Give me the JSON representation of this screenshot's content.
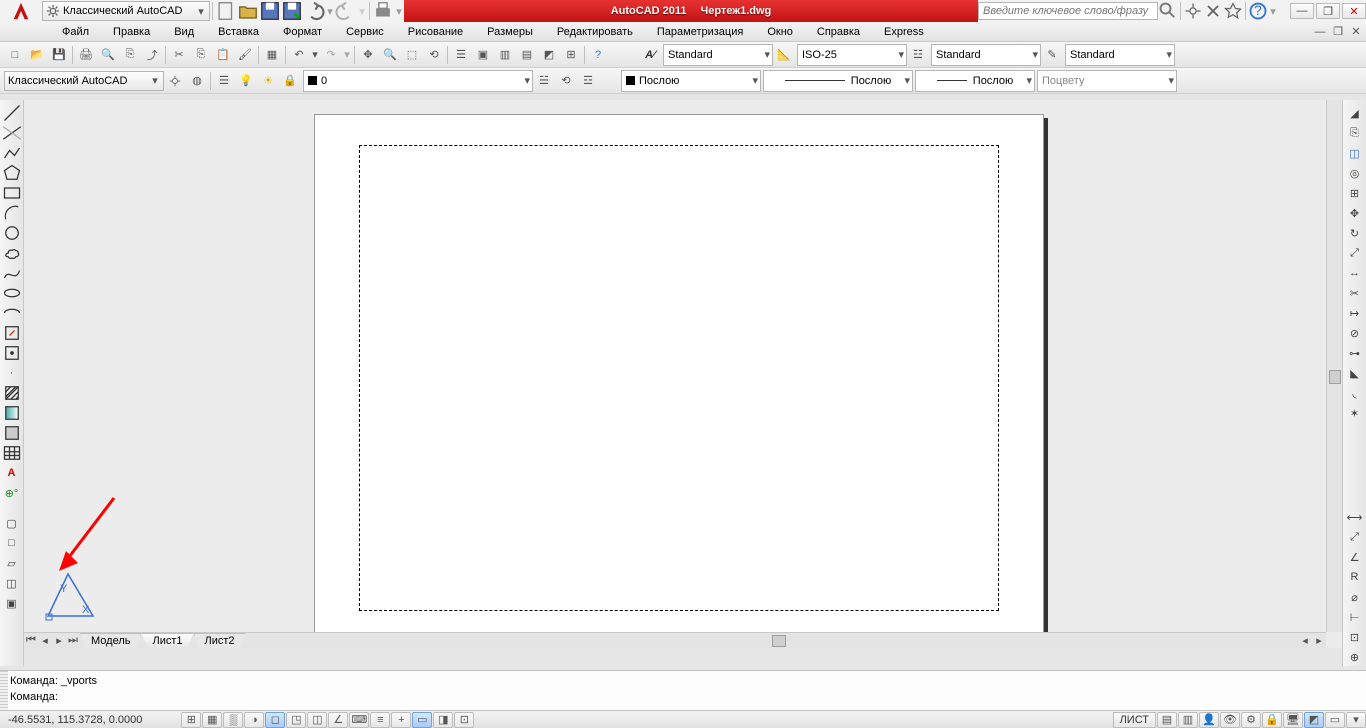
{
  "title": {
    "app": "AutoCAD 2011",
    "file": "Чертеж1.dwg"
  },
  "workspace": "Классический AutoCAD",
  "search_placeholder": "Введите ключевое слово/фразу",
  "menus": [
    "Файл",
    "Правка",
    "Вид",
    "Вставка",
    "Формат",
    "Сервис",
    "Рисование",
    "Размеры",
    "Редактировать",
    "Параметризация",
    "Окно",
    "Справка",
    "Express"
  ],
  "styles": {
    "text": "Standard",
    "dim": "ISO-25",
    "table": "Standard",
    "mleader": "Standard"
  },
  "workspace2": "Классический AutoCAD",
  "layer": "0",
  "props": {
    "color": "Послою",
    "ltype": "Послою",
    "lweight": "Послою",
    "plot": "Поцвету"
  },
  "tabs": {
    "model": "Модель",
    "sheet1": "Лист1",
    "sheet2": "Лист2"
  },
  "cmd": {
    "l1": "Команда: _vports",
    "l2": "Команда:"
  },
  "coords": "-46.5531, 115.3728, 0.0000",
  "layout_label": "ЛИСТ",
  "left_tools": [
    "line",
    "xline",
    "pline",
    "polygon",
    "rect",
    "arc",
    "circle",
    "revcloud",
    "spline",
    "ellipse",
    "ellipse-arc",
    "block",
    "point",
    "hatch",
    "gradient",
    "region",
    "table",
    "text",
    "add-sel",
    "",
    "",
    "",
    ""
  ],
  "right_tools_top": [
    "move",
    "copy",
    "rotate",
    "grid",
    "trim",
    "pan",
    "zoom",
    "scale",
    "stretch",
    "array",
    "chamfer",
    "fillet",
    "join",
    "explode",
    "",
    "",
    "",
    "",
    "",
    "",
    "",
    "",
    "",
    ""
  ],
  "right_tools_bottom": [
    "dim1",
    "dim2",
    "dim3",
    "dim4",
    "dim5",
    "dim6"
  ]
}
